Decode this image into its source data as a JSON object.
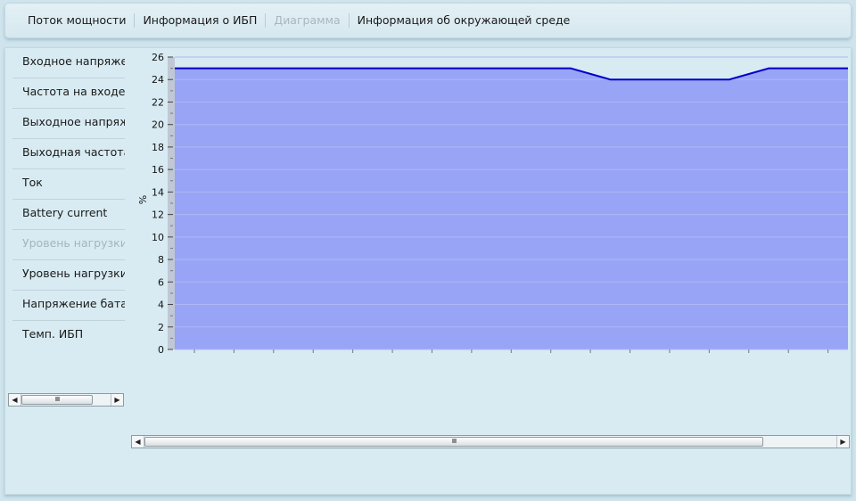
{
  "tabs": [
    {
      "label": "Поток мощности",
      "enabled": true
    },
    {
      "label": "Информация о ИБП",
      "enabled": true
    },
    {
      "label": "Диаграмма",
      "enabled": false
    },
    {
      "label": "Информация об окружающей среде",
      "enabled": true
    }
  ],
  "metrics": [
    {
      "label": "Входное напряжение",
      "enabled": true
    },
    {
      "label": "Частота на входе",
      "enabled": true
    },
    {
      "label": "Выходное напряжение",
      "enabled": true
    },
    {
      "label": "Выходная частота",
      "enabled": true
    },
    {
      "label": "Ток",
      "enabled": true
    },
    {
      "label": "Battery current",
      "enabled": true
    },
    {
      "label": "Уровень нагрузки",
      "enabled": false
    },
    {
      "label": "Уровень нагрузки",
      "enabled": true
    },
    {
      "label": "Напряжение батареи",
      "enabled": true
    },
    {
      "label": "Темп. ИБП",
      "enabled": true
    }
  ],
  "scroll_thumb_grip": "IIIII",
  "colors": {
    "area_fill": "#98a4f6",
    "line": "#0000cc",
    "gridline": "#aeb8f4",
    "panel_bg": "#d8ebf2",
    "tab_disabled": "#a9b7bd"
  },
  "chart_data": {
    "type": "area",
    "title": "",
    "xlabel": "",
    "ylabel": "%",
    "ylim": [
      0,
      26
    ],
    "yticks": [
      0,
      2,
      4,
      6,
      8,
      10,
      12,
      14,
      16,
      18,
      20,
      22,
      24,
      26
    ],
    "grid": true,
    "x": [
      0,
      1,
      2,
      3,
      4,
      5,
      6,
      7,
      8,
      9,
      10,
      11,
      12,
      13,
      14,
      15,
      16,
      17
    ],
    "series": [
      {
        "values": [
          25,
          25,
          25,
          25,
          25,
          25,
          25,
          25,
          25,
          25,
          25,
          24,
          24,
          24,
          24,
          25,
          25,
          25
        ]
      }
    ]
  }
}
